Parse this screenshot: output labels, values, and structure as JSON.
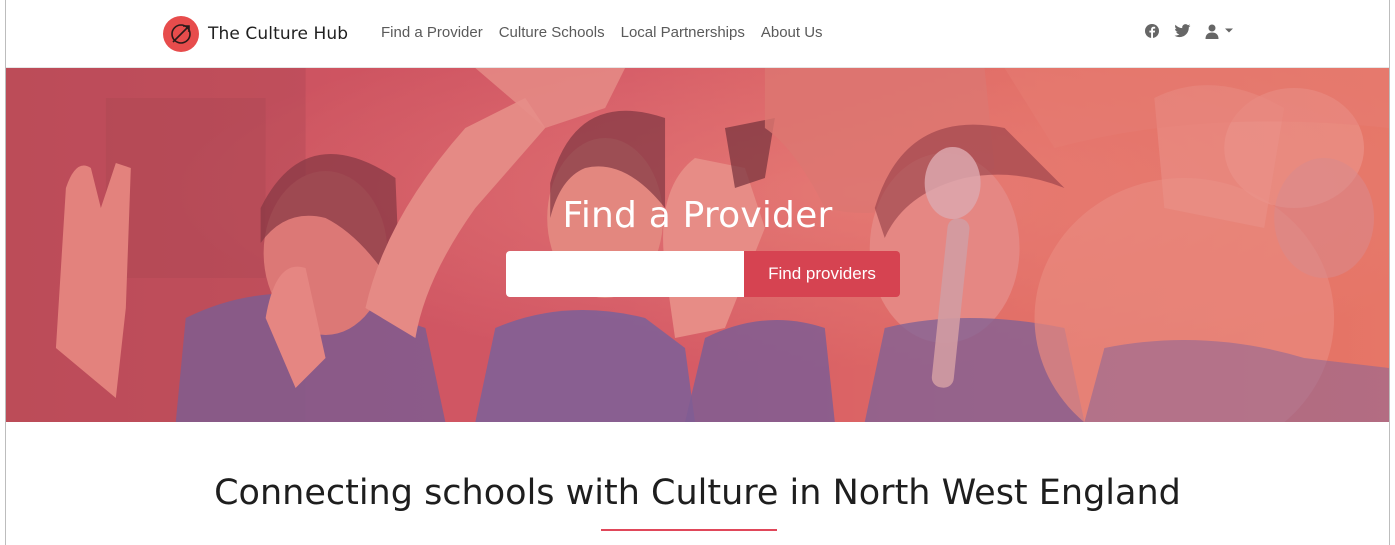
{
  "brand": {
    "name": "The Culture Hub",
    "logo_icon": "compass-arrow-icon",
    "logo_color": "#e74c4c"
  },
  "nav": {
    "links": [
      {
        "label": "Find a Provider"
      },
      {
        "label": "Culture Schools"
      },
      {
        "label": "Local Partnerships"
      },
      {
        "label": "About Us"
      }
    ],
    "icons": [
      "facebook-icon",
      "twitter-icon",
      "user-icon",
      "caret-down-icon"
    ]
  },
  "hero": {
    "title": "Find a Provider",
    "search": {
      "value": "",
      "placeholder": "",
      "button_label": "Find providers"
    },
    "accent_color": "#d64351"
  },
  "main": {
    "tagline": "Connecting schools with Culture in North West England",
    "rule_color": "#e0475a"
  }
}
